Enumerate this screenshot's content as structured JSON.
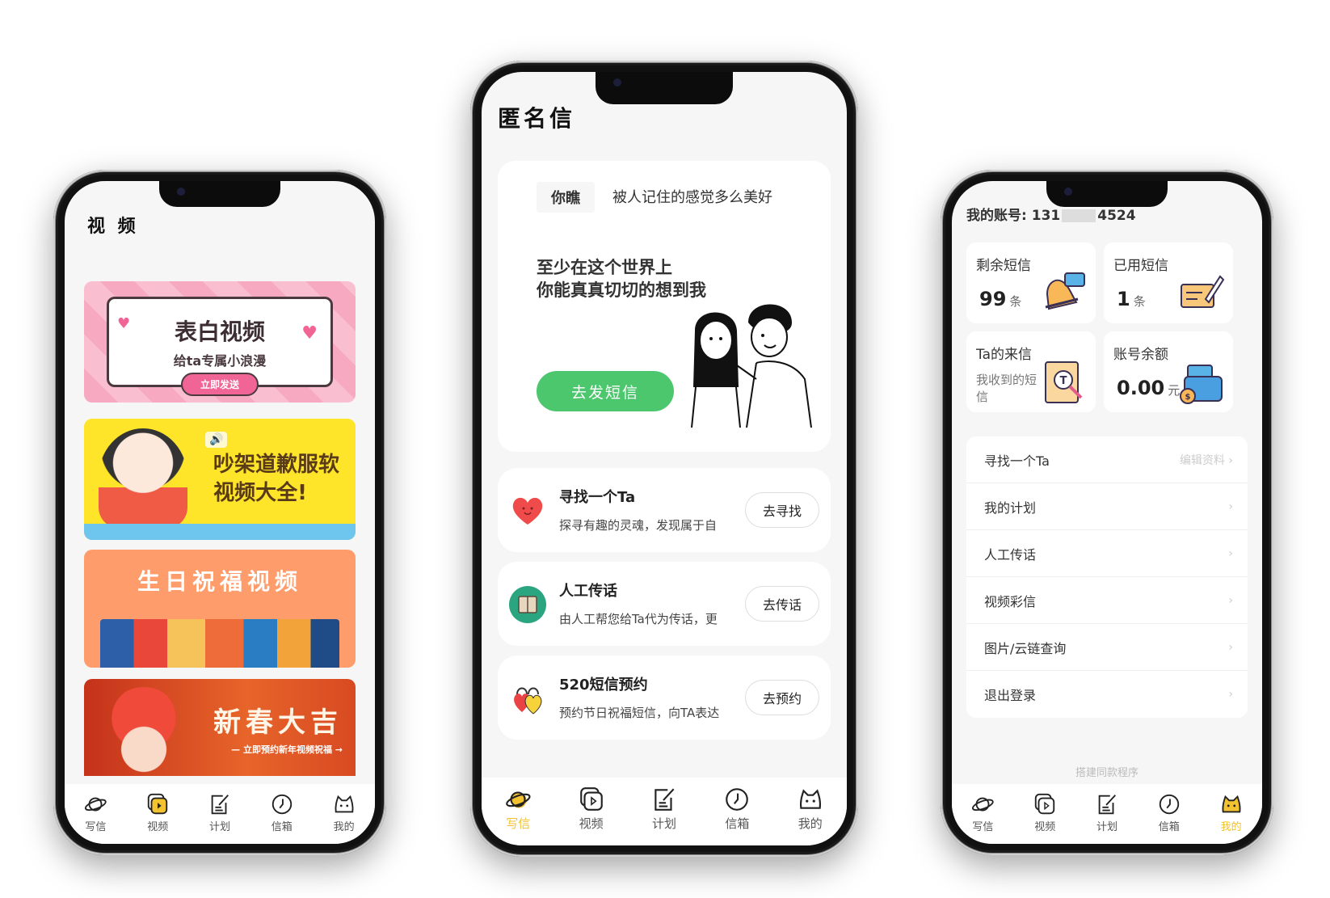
{
  "colors": {
    "accent_yellow": "#f2c230",
    "green_button": "#4cc76e",
    "screen_bg": "#f6f6f6"
  },
  "tabbar": {
    "items": [
      {
        "label": "写信",
        "icon": "planet-icon"
      },
      {
        "label": "视频",
        "icon": "video-icon"
      },
      {
        "label": "计划",
        "icon": "edit-note-icon"
      },
      {
        "label": "信箱",
        "icon": "clock-icon"
      },
      {
        "label": "我的",
        "icon": "cat-icon"
      }
    ]
  },
  "video_page": {
    "title": "视 频",
    "active_tab": "视频",
    "banners": [
      {
        "title": "表白视频",
        "subtitle": "给ta专属小浪漫",
        "button": "立即发送"
      },
      {
        "title_line1": "吵架道歉服软",
        "title_line2": "视频大全!"
      },
      {
        "title": "生日祝福视频"
      },
      {
        "title": "新春大吉",
        "subtitle": "— 立即预约新年视频祝福 →"
      }
    ]
  },
  "letter_page": {
    "title": "匿名信",
    "active_tab": "写信",
    "hero": {
      "tag": "你瞧",
      "tagline": "被人记住的感觉多么美好",
      "headline_line1": "至少在这个世界上",
      "headline_line2": "你能真真切切的想到我",
      "button": "去发短信"
    },
    "features": [
      {
        "title": "寻找一个Ta",
        "desc": "探寻有趣的灵魂，发现属于自",
        "button": "去寻找",
        "icon": "heart-icon"
      },
      {
        "title": "人工传话",
        "desc": "由人工帮您给Ta代为传话，更",
        "button": "去传话",
        "icon": "box-icon"
      },
      {
        "title": "520短信预约",
        "desc": "预约节日祝福短信，向TA表达",
        "button": "去预约",
        "icon": "lock-hearts-icon"
      }
    ]
  },
  "profile_page": {
    "active_tab": "我的",
    "account_label": "我的账号:",
    "account_prefix": "131",
    "account_suffix": "4524",
    "stats": [
      {
        "label": "剩余短信",
        "value": "99",
        "unit": "条",
        "icon": "bell-message-icon"
      },
      {
        "label": "已用短信",
        "value": "1",
        "unit": "条",
        "icon": "letter-pen-icon"
      },
      {
        "label": "Ta的来信",
        "sub": "我收到的短信",
        "icon": "document-search-icon"
      },
      {
        "label": "账号余额",
        "value": "0.00",
        "unit": "元",
        "icon": "wallet-icon"
      }
    ],
    "menu": [
      {
        "label": "寻找一个Ta",
        "right": "编辑资料 ›"
      },
      {
        "label": "我的计划",
        "right": "›"
      },
      {
        "label": "人工传话",
        "right": "›"
      },
      {
        "label": "视频彩信",
        "right": "›"
      },
      {
        "label": "图片/云链查询",
        "right": "›"
      },
      {
        "label": "退出登录",
        "right": "›"
      }
    ],
    "footer_note": "搭建同款程序"
  }
}
